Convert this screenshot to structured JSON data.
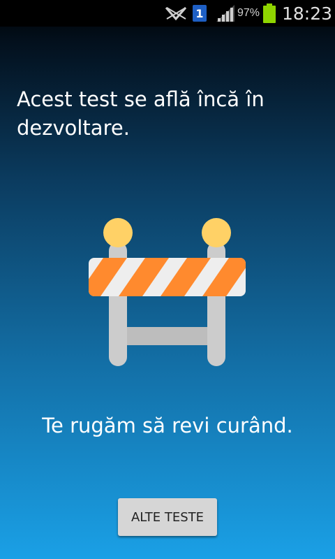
{
  "status_bar": {
    "battery_percent": "97%",
    "sim_slot": "1",
    "time": "18:23",
    "icons": [
      "no-signal-icon",
      "sim-card-icon",
      "signal-strength-icon",
      "battery-charging-icon"
    ],
    "battery_color": "#8fd400"
  },
  "content": {
    "headline": "Acest test se află încă în dezvoltare.",
    "illustration": "construction-barrier-icon",
    "message": "Te rugăm să revi curând.",
    "button_label": "ALTE TESTE"
  },
  "colors": {
    "background_top": "#000000",
    "background_bottom": "#1aa0e6",
    "barrier_stripe_orange": "#ff8a2e",
    "barrier_stripe_white": "#eeeeee",
    "barrier_post": "#cccccc",
    "barrier_lamp": "#ffd166"
  }
}
